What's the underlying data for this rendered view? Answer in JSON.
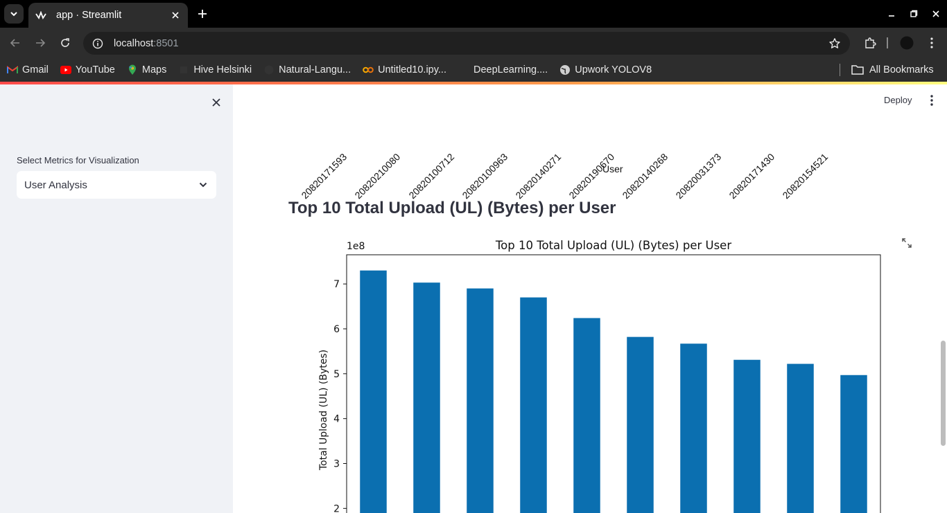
{
  "browser": {
    "tab_title": "app · Streamlit",
    "url_host": "localhost",
    "url_port": ":8501",
    "bookmarks": [
      {
        "label": "Gmail",
        "icon": "gmail-icon"
      },
      {
        "label": "YouTube",
        "icon": "youtube-icon"
      },
      {
        "label": "Maps",
        "icon": "maps-icon"
      },
      {
        "label": "Hive Helsinki",
        "icon": "hive-icon"
      },
      {
        "label": "Natural-Langu...",
        "icon": "github-icon"
      },
      {
        "label": "Untitled10.ipy...",
        "icon": "colab-icon"
      },
      {
        "label": "DeepLearning....",
        "icon": "blank-page-icon"
      },
      {
        "label": "Upwork YOLOV8",
        "icon": "globe-icon"
      }
    ],
    "all_bookmarks": "All Bookmarks"
  },
  "sidebar": {
    "select_label": "Select Metrics for Visualization",
    "select_value": "User Analysis"
  },
  "header": {
    "deploy_label": "Deploy"
  },
  "previous_chart": {
    "xtick_labels": [
      "20820171593",
      "20820210080",
      "20820100712",
      "20820100963",
      "20820140271",
      "20820190670",
      "20820140268",
      "20820031373",
      "20820171430",
      "20820154521"
    ],
    "xlabel": "User"
  },
  "section": {
    "title": "Top 10 Total Upload (UL) (Bytes) per User"
  },
  "chart_data": {
    "type": "bar",
    "title": "Top 10 Total Upload (UL) (Bytes) per User",
    "ylabel": "Total Upload (UL) (Bytes)",
    "offset_text": "1e8",
    "values": [
      7.3,
      7.03,
      6.9,
      6.7,
      6.24,
      5.82,
      5.67,
      5.31,
      5.22,
      4.97
    ],
    "ylim": [
      1.45,
      7.65
    ],
    "yticks": [
      2,
      3,
      4,
      5,
      6,
      7
    ],
    "bar_color": "#0b6fb0",
    "grid": false
  },
  "colors": {
    "sidebar_bg": "#f0f2f6",
    "text": "#31333f",
    "bar": "#0b6fb0"
  }
}
